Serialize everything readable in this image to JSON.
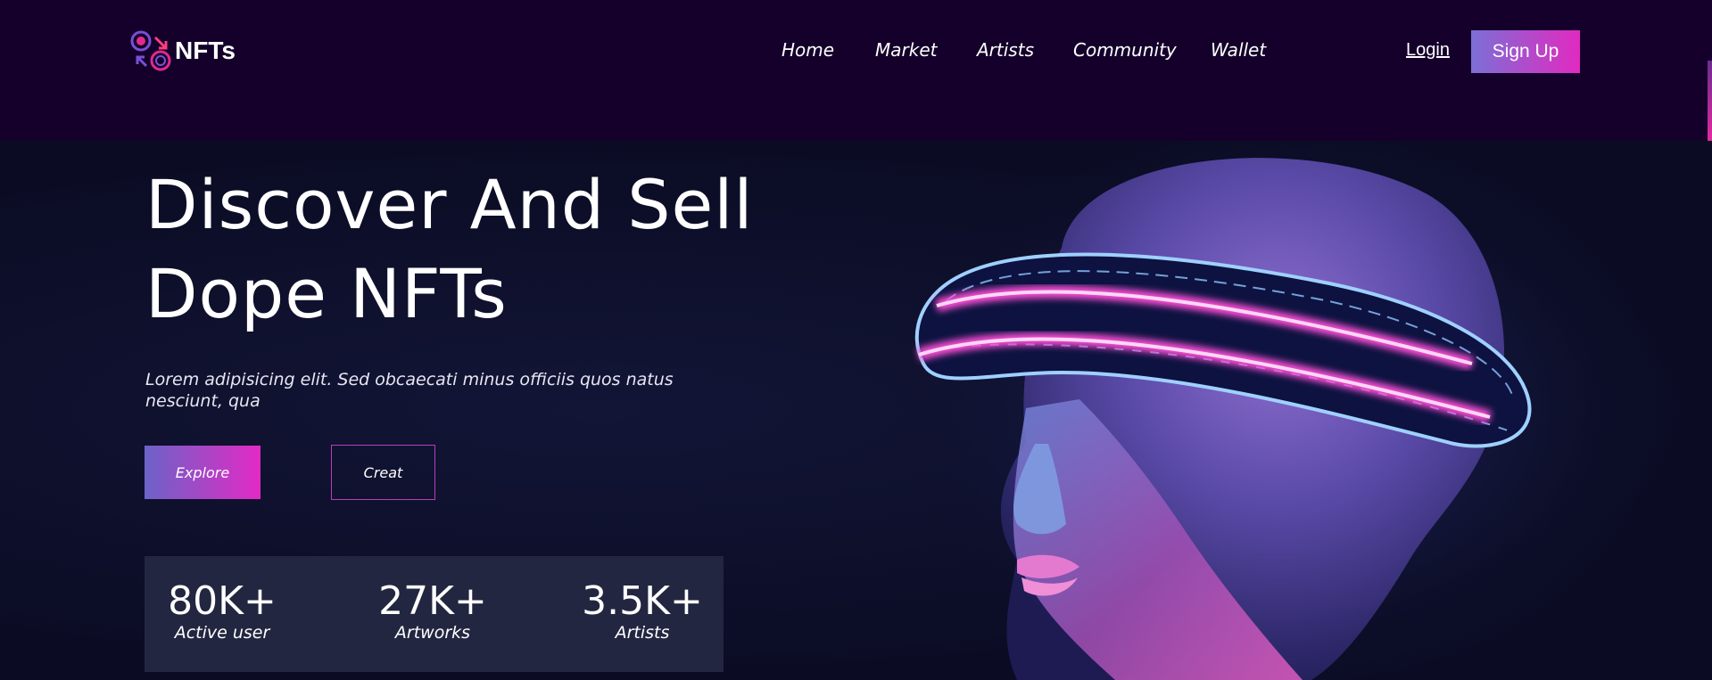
{
  "header": {
    "brand": "NFTs",
    "nav": [
      "Home",
      "Market",
      "Artists",
      "Community",
      "Wallet"
    ],
    "login": "Login",
    "signup": "Sign Up"
  },
  "hero": {
    "title_line1": "Discover And Sell",
    "title_line2": "Dope NFTs",
    "description": "Lorem adipisicing elit. Sed obcaecati minus officiis quos natus nesciunt, qua",
    "explore": "Explore",
    "create": "Creat",
    "stats": [
      {
        "value": "80K+",
        "label": "Active user"
      },
      {
        "value": "27K+",
        "label": "Artworks"
      },
      {
        "value": "3.5K+",
        "label": "Artists"
      }
    ]
  },
  "colors": {
    "header_bg": "#14002b",
    "page_bg": "#0b0c24",
    "accent_start": "#7c6fd6",
    "accent_end": "#e12ac0",
    "stats_bg": "#232640"
  },
  "icons": [
    "logo-icon"
  ],
  "image": "hero-image"
}
